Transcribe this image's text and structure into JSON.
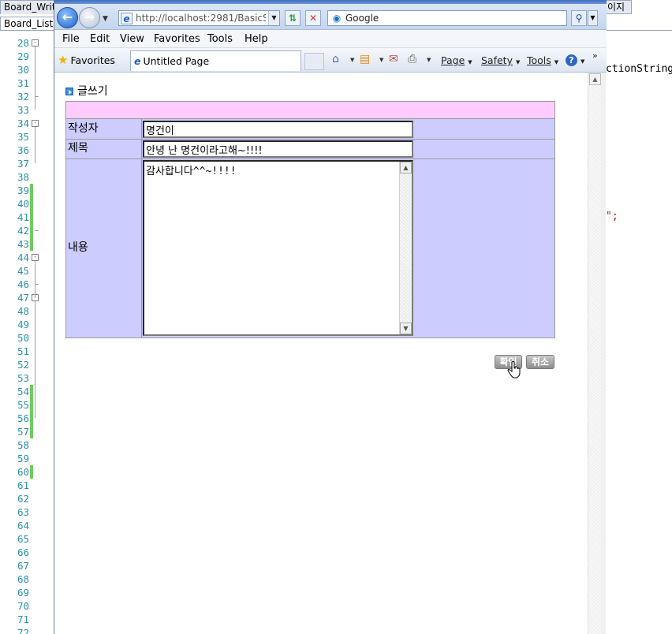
{
  "ide": {
    "tabs": {
      "write": "Board_Writ",
      "list": "Board_List",
      "right": "이지"
    },
    "code_lines": [
      "28",
      "29",
      "30",
      "31",
      "32",
      "33",
      "34",
      "35",
      "36",
      "37",
      "38",
      "39",
      "40",
      "41",
      "42",
      "43",
      "44",
      "45",
      "46",
      "47",
      "48",
      "49",
      "50",
      "51",
      "52",
      "53",
      "54",
      "55",
      "56",
      "57",
      "58",
      "59",
      "60",
      "61",
      "62",
      "63",
      "64",
      "65",
      "66",
      "67",
      "68",
      "69",
      "70",
      "71",
      "72"
    ],
    "code_fragment_1": "ctionString",
    "code_fragment_2": "\";"
  },
  "browser": {
    "address": {
      "value": "http://localhost:2981/BasicS"
    },
    "search": {
      "value": "Google"
    },
    "menu": [
      "File",
      "Edit",
      "View",
      "Favorites",
      "Tools",
      "Help"
    ],
    "favorites_label": "Favorites",
    "tab_title": "Untitled Page",
    "commands": {
      "page": "Page",
      "safety": "Safety",
      "tools": "Tools"
    }
  },
  "page": {
    "section_title": "글쓰기",
    "form": {
      "author_label": "작성자",
      "author_value": "명건이",
      "subject_label": "제목",
      "subject_value": "안녕 난 명건이라고해~!!!!",
      "content_label": "내용",
      "content_value": "감사합니다^^~!!!!"
    },
    "buttons": {
      "confirm": "확인",
      "cancel": "취소"
    }
  },
  "colors": {
    "form_header_strip": "#ffccff",
    "form_background": "#ccccff",
    "line_number": "#2b91af",
    "change_marker": "#6fcc5e"
  }
}
